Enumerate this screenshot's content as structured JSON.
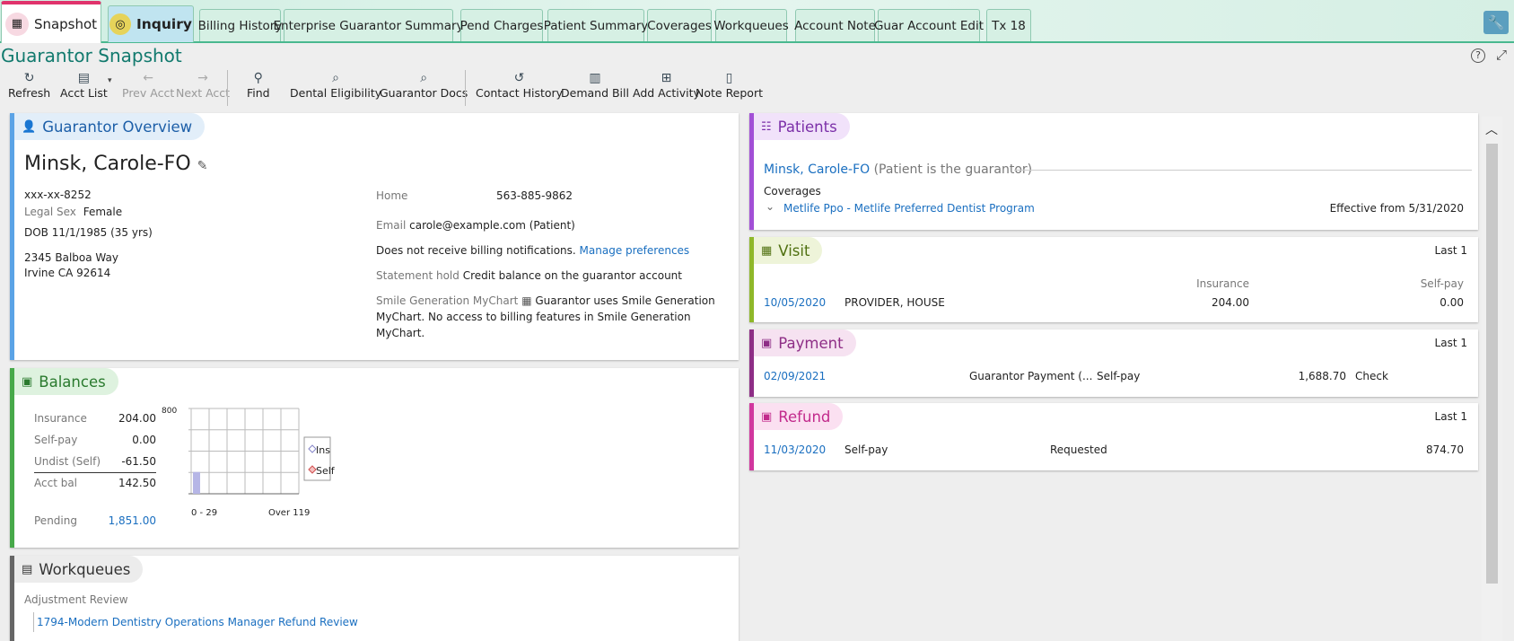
{
  "tabs": [
    {
      "label": "Snapshot"
    },
    {
      "label": "Inquiry"
    },
    {
      "label": "Billing History"
    },
    {
      "label": "Enterprise Guarantor Summary"
    },
    {
      "label": "Pend Charges"
    },
    {
      "label": "Patient Summary"
    },
    {
      "label": "Coverages"
    },
    {
      "label": "Workqueues"
    },
    {
      "label": "Account Note"
    },
    {
      "label": "Guar Account Edit"
    },
    {
      "label": "Tx 18"
    }
  ],
  "activity_title": "Guarantor Snapshot",
  "toolbar": {
    "refresh": "Refresh",
    "acct_list": "Acct List",
    "prev_acct": "Prev Acct",
    "next_acct": "Next Acct",
    "find": "Find",
    "dental_eligibility": "Dental Eligibility",
    "guarantor_docs": "Guarantor Docs",
    "contact_history": "Contact History",
    "demand_bill": "Demand Bill",
    "add_activity": "Add Activity",
    "note_report": "Note Report"
  },
  "overview": {
    "title": "Guarantor Overview",
    "name": "Minsk, Carole-FO",
    "ssn": "xxx-xx-8252",
    "legal_sex_label": "Legal Sex",
    "legal_sex": "Female",
    "dob": "DOB 11/1/1985 (35 yrs)",
    "address1": "2345 Balboa Way",
    "address2": "Irvine CA 92614",
    "home_label": "Home",
    "home": "563-885-9862",
    "email_label": "Email",
    "email": "carole@example.com (Patient)",
    "billing_notice": "Does not receive billing notifications.",
    "manage_prefs": "Manage preferences",
    "statement_hold_label": "Statement hold",
    "statement_hold": "Credit balance on the guarantor account",
    "mychart_label": "Smile Generation MyChart",
    "mychart_line1": "Guarantor uses Smile Generation",
    "mychart_line2": "MyChart. No access to billing features in Smile Generation",
    "mychart_line3": "MyChart."
  },
  "balances": {
    "title": "Balances",
    "rows": [
      {
        "label": "Insurance",
        "value": "204.00"
      },
      {
        "label": "Self-pay",
        "value": "0.00"
      },
      {
        "label": "Undist (Self)",
        "value": "-61.50"
      },
      {
        "label": "Acct bal",
        "value": "142.50"
      }
    ],
    "pending_label": "Pending",
    "pending": "1,851.00"
  },
  "chart_data": {
    "type": "bar",
    "categories": [
      "0 - 29",
      "",
      "",
      "",
      "",
      "Over 119"
    ],
    "series": [
      {
        "name": "Ins",
        "values": [
          204,
          0,
          0,
          0,
          0,
          0
        ]
      },
      {
        "name": "Self",
        "values": [
          0,
          0,
          0,
          0,
          0,
          0
        ]
      }
    ],
    "ylim": [
      0,
      800
    ],
    "y_tick_label": "800",
    "x_tick_first": "0 - 29",
    "x_tick_last": "Over 119",
    "legend": [
      "Ins",
      "Self"
    ],
    "colors": {
      "Ins": "#b6b6e6",
      "Self": "#e87878"
    }
  },
  "workqueues": {
    "title": "Workqueues",
    "section": "Adjustment Review",
    "item": "1794-Modern Dentistry Operations Manager Refund Review"
  },
  "patients": {
    "title": "Patients",
    "name": "Minsk, Carole-FO",
    "note": "(Patient is the guarantor)",
    "coverages_label": "Coverages",
    "coverage": "Metlife Ppo - Metlife Preferred Dentist Program",
    "effective": "Effective from 5/31/2020"
  },
  "visit": {
    "title": "Visit",
    "last": "Last 1",
    "col_ins": "Insurance",
    "col_self": "Self-pay",
    "date": "10/05/2020",
    "provider": "PROVIDER, HOUSE",
    "ins": "204.00",
    "self": "0.00"
  },
  "payment": {
    "title": "Payment",
    "last": "Last 1",
    "date": "02/09/2021",
    "desc": "Guarantor Payment (...",
    "type": "Self-pay",
    "amount": "1,688.70",
    "method": "Check"
  },
  "refund": {
    "title": "Refund",
    "last": "Last 1",
    "date": "11/03/2020",
    "type": "Self-pay",
    "status": "Requested",
    "amount": "874.70"
  }
}
